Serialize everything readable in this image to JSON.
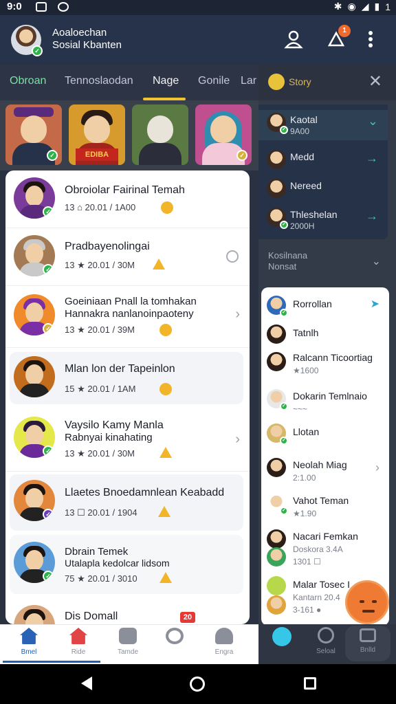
{
  "status_bar": {
    "time": "9:0",
    "right_text": "1"
  },
  "header": {
    "title_line1": "Aoaloechan",
    "title_line2": "Sosial Kbanten",
    "notif_badge": "1"
  },
  "tabs": [
    {
      "label": "Obroan",
      "state": "active"
    },
    {
      "label": "Tennoslaodan",
      "state": "normal"
    },
    {
      "label": "Nage",
      "state": "selected"
    },
    {
      "label": "Gonile",
      "state": "normal"
    },
    {
      "label": "Lar",
      "state": "normal"
    }
  ],
  "stories": [
    {
      "bg": "#c56a48",
      "shirt": "#1f2a40",
      "hat": "#5a2a7c"
    },
    {
      "bg": "#d79b2d",
      "shirt": "#a1241d",
      "banner": "EDIBA"
    },
    {
      "bg": "#5b7a43",
      "shirt": "#2b2d3a"
    },
    {
      "bg": "#c04f8f",
      "shirt": "#f3c9d9",
      "hijab": "#2f8eb0"
    }
  ],
  "chats": [
    {
      "name": "Obroiolar Fairinal Temah",
      "sub": "",
      "meta": "13 ⌂ 20.01 / 1A00",
      "ava_bg": "#7a3b9a",
      "check": "green"
    },
    {
      "name": "Pradbayenolingai",
      "sub": "",
      "meta": "13 ★ 20.01 / 30M",
      "ava_bg": "#a47a55",
      "check": "green"
    },
    {
      "name": "Goeiniaan Pnall la tomhakan",
      "sub": "Hannakra nanlanoinpaoteny",
      "meta": "13 ★ 20.01 / 39M",
      "ava_bg": "#f08a2a",
      "check": "gold"
    },
    {
      "name": "Mlan lon der Tapeinlon",
      "sub": "",
      "meta": "15 ★ 20.01 / 1AM",
      "ava_bg": "#c26c1e",
      "check": ""
    },
    {
      "name": "Vaysilo Kamy Manla",
      "sub": "Rabnyai kinahating",
      "meta": "13 ★ 20.01 / 30M",
      "ava_bg": "#e4e84a",
      "check": "green"
    },
    {
      "name": "Llaetes Bnoedamnlean Keabadd",
      "sub": "",
      "meta": "13 ☐ 20.01 / 1904",
      "ava_bg": "#e2873c",
      "check": "purple"
    },
    {
      "name": "Dbrain Temek",
      "sub": "Utalapla kedolcar lidsom",
      "meta": "75 ★ 20.01 / 3010",
      "ava_bg": "#5b9bd8",
      "check": "green"
    },
    {
      "name": "Dis Domall",
      "sub": "",
      "meta": "",
      "ava_bg": "#d9a57a",
      "check": "",
      "badge": "20"
    }
  ],
  "bottom_nav": [
    {
      "label": "Bmel",
      "color": "#2a63b5",
      "active": true
    },
    {
      "label": "Ride",
      "color": "#e04444",
      "active": false
    },
    {
      "label": "Tamde",
      "color": "#8a8f9a",
      "active": false
    },
    {
      "label": "",
      "color": "#8a8f9a",
      "active": false
    },
    {
      "label": "Engra",
      "color": "#8a8f9a",
      "active": false
    }
  ],
  "right_panel": {
    "header_title": "Story",
    "list": [
      {
        "name": "Kaotal",
        "sub": "9A00",
        "action": "chevron",
        "check": true
      },
      {
        "name": "Medd",
        "sub": "",
        "action": "arrow"
      },
      {
        "name": "Nereed",
        "sub": "",
        "action": ""
      },
      {
        "name": "Thleshelan",
        "sub": "2000H",
        "action": "arrow",
        "check": true
      }
    ],
    "section_line1": "Kosilnana",
    "section_line2": "Nonsat",
    "contacts": [
      {
        "name": "Rorrollan",
        "sub": "",
        "check": true,
        "action": "send"
      },
      {
        "name": "Tatnlh",
        "sub": ""
      },
      {
        "name": "Ralcann Ticoortiag",
        "sub": "★1600"
      },
      {
        "name": "Dokarin Temlnaio",
        "sub": "~~~",
        "check": true
      },
      {
        "name": "Llotan",
        "sub": "",
        "check": true
      },
      {
        "name": "Neolah Miag",
        "sub": "2:1.00",
        "action": "chevron"
      },
      {
        "name": "Vahot Teman",
        "sub": "★1.90",
        "check": true
      },
      {
        "name": "Nacari Femkan",
        "sub": "Doskora 3.4A",
        "sub2": "1301 ☐"
      },
      {
        "name": "Malar Tosec I",
        "sub": "Kantarn 20.4",
        "sub2": "3-161 ●"
      }
    ],
    "nav": [
      {
        "label": ""
      },
      {
        "label": "Seloal"
      },
      {
        "label": "Bnlld"
      }
    ]
  }
}
